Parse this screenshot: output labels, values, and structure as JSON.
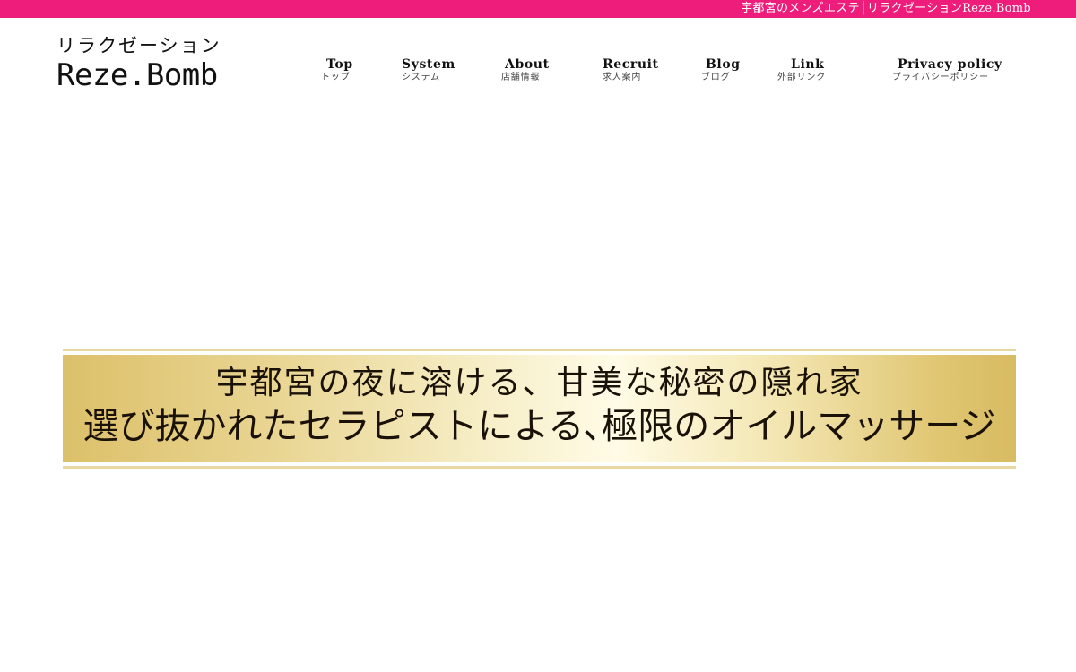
{
  "topbar": {
    "text": "宇都宮のメンズエステ│リラクゼーションReze.Bomb",
    "color": "#ee1c7a"
  },
  "logo": {
    "subtitle": "リラクゼーション",
    "name": "Reze.Bomb"
  },
  "nav": [
    {
      "label": "Top",
      "sub": "トップ"
    },
    {
      "label": "System",
      "sub": "システム"
    },
    {
      "label": "About",
      "sub": "店舗情報"
    },
    {
      "label": "Recruit",
      "sub": "求人案内"
    },
    {
      "label": "Blog",
      "sub": "ブログ"
    },
    {
      "label": "Link",
      "sub": "外部リンク"
    },
    {
      "label": "Privacy policy",
      "sub": "プライバシーポリシー"
    }
  ],
  "banner": {
    "line1": "宇都宮の夜に溶ける、甘美な秘密の隠れ家",
    "line2": "選び抜かれたセラピストによる､極限のオイルマッサージ",
    "gold_color": "#e0c672"
  }
}
